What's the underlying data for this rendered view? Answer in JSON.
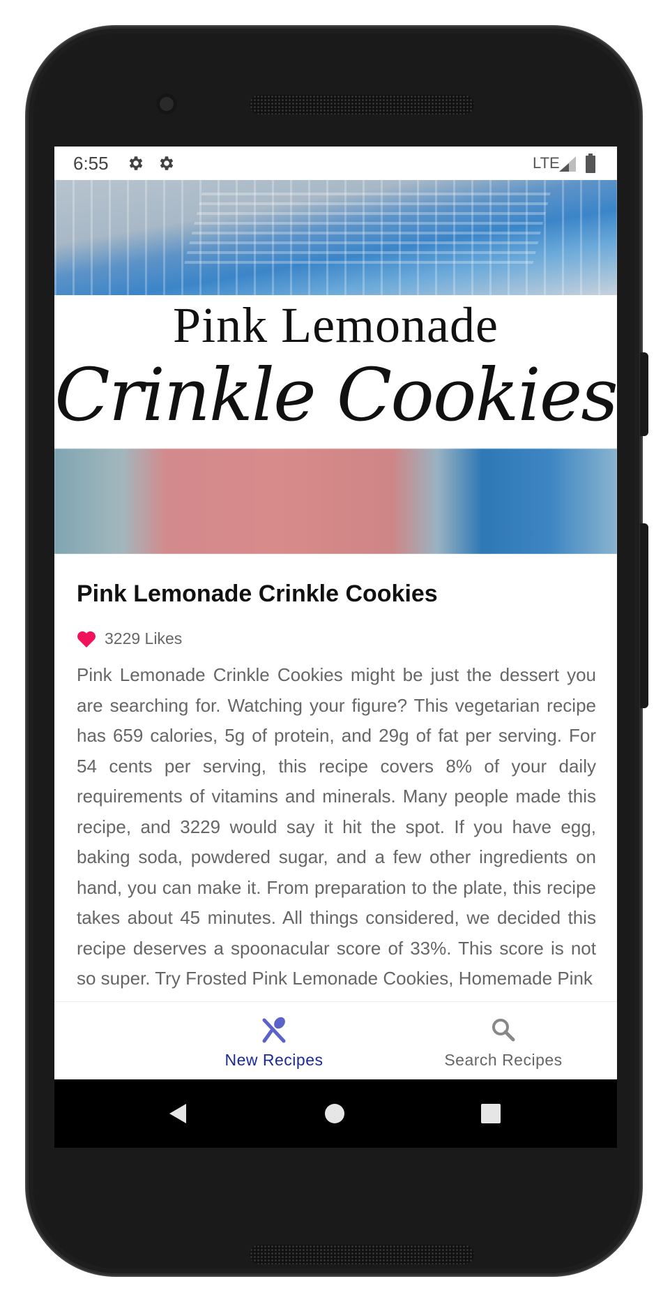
{
  "status_bar": {
    "time": "6:55",
    "network": "LTE",
    "icons": [
      "gear-icon",
      "gear-icon",
      "signal-icon",
      "battery-icon"
    ]
  },
  "hero_image": {
    "line1": "Pink Lemonade",
    "line2": "Crinkle Cookies"
  },
  "recipe": {
    "title": "Pink Lemonade Crinkle Cookies",
    "likes": "3229 Likes",
    "summary": "Pink Lemonade Crinkle Cookies might be just the dessert you are searching for. Watching your figure? This vegetarian recipe has 659 calories, 5g of protein, and 29g of fat per serving. For 54 cents per serving, this recipe covers 8% of your daily requirements of vitamins and minerals. Many people made this recipe, and 3229 would say it hit the spot. If you have egg, baking soda, powdered sugar, and a few other ingredients on hand, you can make it. From preparation to the plate, this recipe takes about 45 minutes. All things considered, we decided this recipe deserves a spoonacular score of 33%. This score is not so super. Try Frosted Pink Lemonade Cookies, Homemade Pink"
  },
  "bottom_nav": {
    "items": [
      {
        "label": "New Recipes",
        "icon": "utensils-icon",
        "active": true
      },
      {
        "label": "Search Recipes",
        "icon": "search-icon",
        "active": false
      }
    ]
  },
  "colors": {
    "accent": "#1a2a9a",
    "active_icon": "#5b62c9",
    "heart": "#f0135c",
    "text_secondary": "#666666"
  }
}
